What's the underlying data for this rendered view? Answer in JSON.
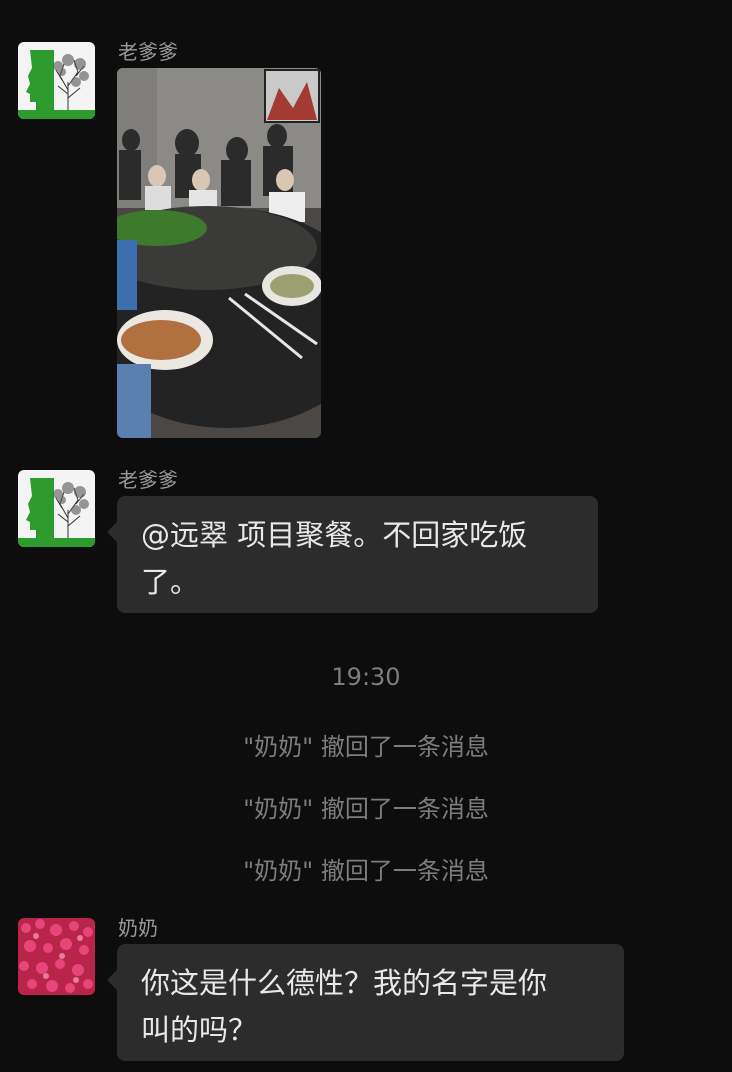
{
  "messages": [
    {
      "type": "image",
      "sender": "老爹爹",
      "avatar_icon": "face-tree-avatar-icon",
      "image_desc_icon": "dinner-table-photo"
    },
    {
      "type": "text",
      "sender": "老爹爹",
      "avatar_icon": "face-tree-avatar-icon",
      "lines": [
        "@远翠 项目聚餐。不回家吃饭",
        "了。"
      ]
    }
  ],
  "timestamp": "19:30",
  "recall_notices": [
    "\"奶奶\" 撤回了一条消息",
    "\"奶奶\" 撤回了一条消息",
    "\"奶奶\" 撤回了一条消息"
  ],
  "last_message": {
    "sender": "奶奶",
    "avatar_icon": "tulip-field-avatar-icon",
    "lines": [
      "你这是什么德性？我的名字是你",
      "叫的吗？"
    ]
  },
  "colors": {
    "background": "#0d0d0d",
    "bubble": "#2c2c2c",
    "sender_name": "#9a9a9a",
    "system_text": "#7d7d7d",
    "avatar_green": "#2e8b2e"
  }
}
